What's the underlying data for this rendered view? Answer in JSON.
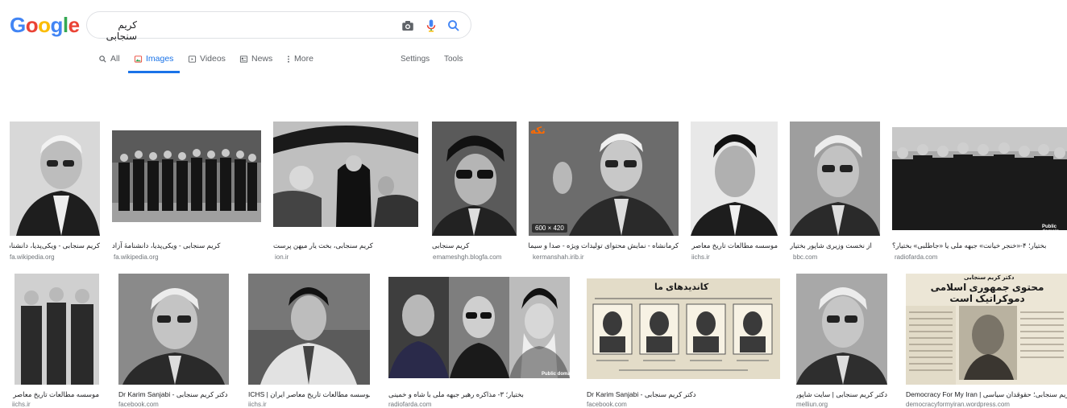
{
  "logo": {
    "letters": [
      "G",
      "o",
      "o",
      "g",
      "l",
      "e"
    ],
    "colors": [
      "#4285f4",
      "#ea4335",
      "#fbbc05",
      "#4285f4",
      "#34a853",
      "#ea4335"
    ]
  },
  "search": {
    "query": "کریم سنجابی"
  },
  "icons": {
    "camera": "camera-icon",
    "mic": "mic-icon",
    "search": "search-icon"
  },
  "tabs": [
    {
      "label": "All",
      "icon": "search-icon"
    },
    {
      "label": "Images",
      "icon": "image-icon"
    },
    {
      "label": "Videos",
      "icon": "play-icon"
    },
    {
      "label": "News",
      "icon": "news-icon"
    },
    {
      "label": "More",
      "icon": "more-icon"
    }
  ],
  "tools": {
    "settings": "Settings",
    "tools": "Tools"
  },
  "results_row1": [
    {
      "caption": "کریم سنجابی - ویکی‌پدیا، دانشنامهٔ آزاد",
      "source": "fa.wikipedia.org"
    },
    {
      "caption": "کریم سنجابی - ویکی‌پدیا، دانشنامهٔ آزاد",
      "source": "fa.wikipedia.org"
    },
    {
      "caption": "کریم سنجابی، بخت یار میهن پرست",
      "source": "ion.ir"
    },
    {
      "caption": "کریم سنجابی",
      "source": "emameshgh.blogfa.com"
    },
    {
      "caption": "کرمانشاه - نمایش محتوای تولیدات ویژه - صدا و سیمای",
      "source": "kermanshah.irib.ir"
    },
    {
      "caption": "موسسه مطالعات تاریخ معاصر ایران",
      "source": "iichs.ir"
    },
    {
      "caption": "از نخست وزیری شاپور بختیار",
      "source": "bbc.com"
    },
    {
      "caption": "بختیار؛ ۴-«خنجر خیانت» جبهه ملی یا «جاطلبی» بختیار؟",
      "source": "radiofarda.com"
    }
  ],
  "results_row2": [
    {
      "caption": "موسسه مطالعات تاریخ معاصر ایران",
      "source": "iichs.ir"
    },
    {
      "caption": "Dr Karim Sanjabi - دکتر کریم سنجابی",
      "source": "facebook.com"
    },
    {
      "caption": "ICHS | موسسه مطالعات تاریخ معاصر ایران",
      "source": "iichs.ir"
    },
    {
      "caption": "بختیار؛ ۳- مذاکره رهبر جبهه ملی با شاه و خمینی",
      "source": "radiofarda.com"
    },
    {
      "caption": "Dr Karim Sanjabi - دکتر کریم سنجابی",
      "source": "facebook.com"
    },
    {
      "caption": "دکتر کریم سنجابی | سایت شاپور بختیار",
      "source": "melliun.org"
    },
    {
      "caption": "Democracy For My Iran | دکتر کریم سنجابی؛ حقوقدان سیاسی",
      "source": "democracyformyiran.wordpress.com"
    }
  ],
  "overlays": {
    "size_badge": "600 × 420",
    "brand": "تکه",
    "public_domain_1": "Public domain",
    "public_domain_2": "Public domain",
    "poster_title": "کاندیدهای ما",
    "newspaper_title": "محتوی جمهوری اسلامی دموکراتیک است",
    "newspaper_header": "دکتر کریم سنجابی"
  }
}
